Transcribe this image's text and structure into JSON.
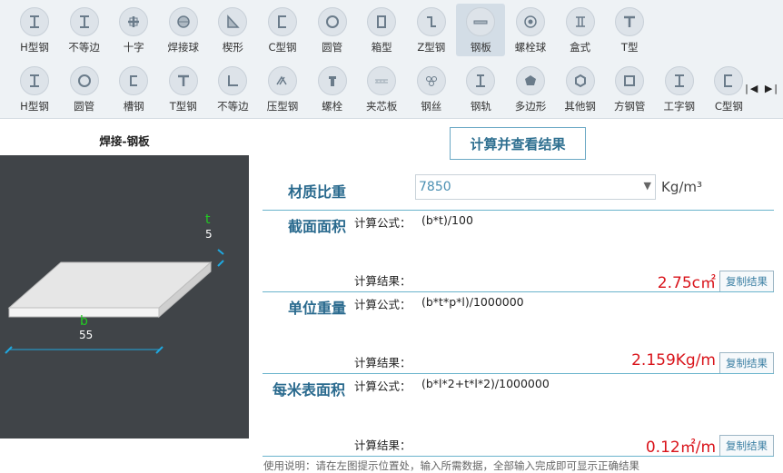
{
  "toolbar": {
    "row1": [
      {
        "label": "H型钢",
        "icon": "i-beam-icon"
      },
      {
        "label": "不等边",
        "icon": "i-beam-icon"
      },
      {
        "label": "十字",
        "icon": "cross-icon"
      },
      {
        "label": "焊接球",
        "icon": "sphere-icon"
      },
      {
        "label": "楔形",
        "icon": "wedge-icon"
      },
      {
        "label": "C型钢",
        "icon": "c-channel-icon"
      },
      {
        "label": "圆管",
        "icon": "round-tube-icon"
      },
      {
        "label": "箱型",
        "icon": "box-icon"
      },
      {
        "label": "Z型钢",
        "icon": "z-section-icon"
      },
      {
        "label": "钢板",
        "icon": "plate-icon"
      },
      {
        "label": "螺栓球",
        "icon": "bolt-ball-icon"
      },
      {
        "label": "盒式",
        "icon": "box-type-icon"
      },
      {
        "label": "T型",
        "icon": "t-section-icon"
      }
    ],
    "row2": [
      {
        "label": "H型钢",
        "icon": "i-beam-icon"
      },
      {
        "label": "圆管",
        "icon": "round-tube-icon"
      },
      {
        "label": "槽钢",
        "icon": "channel-icon"
      },
      {
        "label": "T型钢",
        "icon": "t-section-icon"
      },
      {
        "label": "不等边",
        "icon": "angle-icon"
      },
      {
        "label": "压型钢",
        "icon": "profiled-steel-icon"
      },
      {
        "label": "螺栓",
        "icon": "bolt-icon"
      },
      {
        "label": "夹芯板",
        "icon": "sandwich-panel-icon"
      },
      {
        "label": "钢丝",
        "icon": "steel-wire-icon"
      },
      {
        "label": "钢轨",
        "icon": "rail-icon"
      },
      {
        "label": "多边形",
        "icon": "polygon-icon"
      },
      {
        "label": "其他钢",
        "icon": "other-steel-icon"
      },
      {
        "label": "方钢管",
        "icon": "square-tube-icon"
      },
      {
        "label": "工字钢",
        "icon": "i-beam-icon"
      },
      {
        "label": "C型钢",
        "icon": "c-channel-icon"
      }
    ],
    "active": "钢板"
  },
  "left": {
    "title": "焊接-钢板",
    "dim_t_name": "t",
    "dim_t_value": "5",
    "dim_b_name": "b",
    "dim_b_value": "55"
  },
  "calc_button": "计算并查看结果",
  "density": {
    "title": "材质比重",
    "value": "7850",
    "unit": "Kg/m³"
  },
  "sections": [
    {
      "title": "截面面积",
      "formula_label": "计算公式：",
      "formula": "(b*t)/100",
      "result_label": "计算结果：",
      "result": "2.75c㎡",
      "copy": "复制结果"
    },
    {
      "title": "单位重量",
      "formula_label": "计算公式：",
      "formula": "(b*t*p*l)/1000000",
      "result_label": "计算结果：",
      "result": "2.159Kg/m",
      "copy": "复制结果"
    },
    {
      "title": "每米表面积",
      "formula_label": "计算公式：",
      "formula": "(b*l*2+t*l*2)/1000000",
      "result_label": "计算结果：",
      "result": "0.12㎡/m",
      "copy": "复制结果"
    }
  ],
  "usage": "使用说明：请在左图提示位置处，输入所需数据，全部输入完成即可显示正确结果",
  "nav_arrows": "|◀ ▶|",
  "colors": {
    "accent": "#2a6a8e",
    "result": "#d9141b",
    "separator": "#6ab4cc",
    "dim_label": "#22cc22",
    "dim_marker": "#1fa8e0"
  }
}
